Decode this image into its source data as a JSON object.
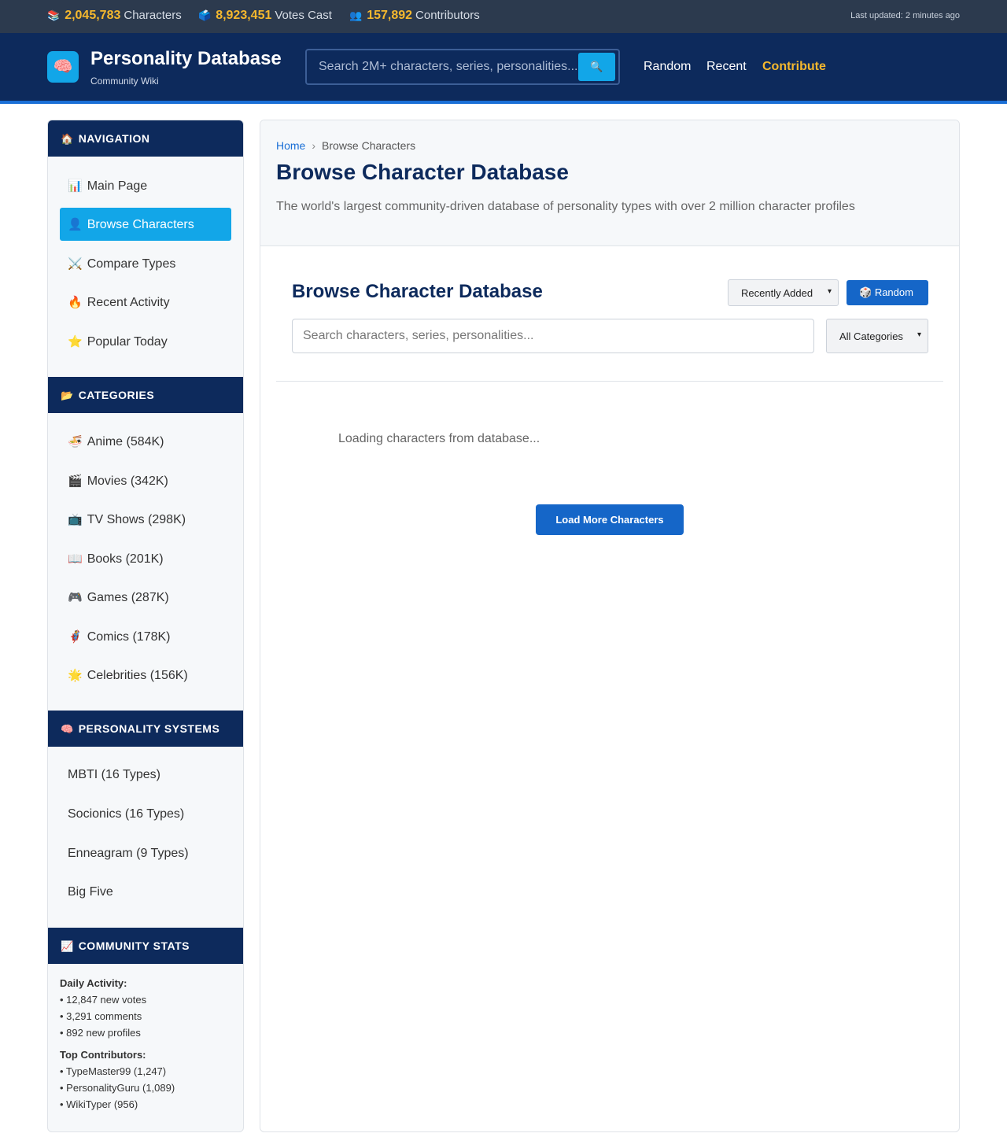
{
  "topbar": {
    "stats": [
      {
        "icon": "📚",
        "value": "2,045,783",
        "label": "Characters"
      },
      {
        "icon": "🗳️",
        "value": "8,923,451",
        "label": "Votes Cast"
      },
      {
        "icon": "👥",
        "value": "157,892",
        "label": "Contributors"
      }
    ],
    "updated": "Last updated: 2 minutes ago"
  },
  "header": {
    "logo_icon": "🧠",
    "title": "Personality Database",
    "subtitle": "Community Wiki",
    "search_placeholder": "Search 2M+ characters, series, personalities...",
    "search_icon": "🔍",
    "nav": [
      "Random",
      "Recent",
      "Contribute"
    ]
  },
  "sidebar": {
    "navigation": {
      "icon": "🏠",
      "title": "NAVIGATION",
      "items": [
        {
          "icon": "📊",
          "label": "Main Page"
        },
        {
          "icon": "👤",
          "label": "Browse Characters"
        },
        {
          "icon": "⚔️",
          "label": "Compare Types"
        },
        {
          "icon": "🔥",
          "label": "Recent Activity"
        },
        {
          "icon": "⭐",
          "label": "Popular Today"
        }
      ]
    },
    "categories": {
      "icon": "📂",
      "title": "CATEGORIES",
      "items": [
        {
          "icon": "🍜",
          "label": "Anime (584K)"
        },
        {
          "icon": "🎬",
          "label": "Movies (342K)"
        },
        {
          "icon": "📺",
          "label": "TV Shows (298K)"
        },
        {
          "icon": "📖",
          "label": "Books (201K)"
        },
        {
          "icon": "🎮",
          "label": "Games (287K)"
        },
        {
          "icon": "🦸",
          "label": "Comics (178K)"
        },
        {
          "icon": "🌟",
          "label": "Celebrities (156K)"
        }
      ]
    },
    "systems": {
      "icon": "🧠",
      "title": "PERSONALITY SYSTEMS",
      "items": [
        {
          "label": "MBTI (16 Types)"
        },
        {
          "label": "Socionics (16 Types)"
        },
        {
          "label": "Enneagram (9 Types)"
        },
        {
          "label": "Big Five"
        }
      ]
    },
    "community": {
      "icon": "📈",
      "title": "COMMUNITY STATS",
      "daily_label": "Daily Activity:",
      "daily": [
        "• 12,847 new votes",
        "• 3,291 comments",
        "• 892 new profiles"
      ],
      "top_label": "Top Contributors:",
      "top": [
        "• TypeMaster99 (1,247)",
        "• PersonalityGuru (1,089)",
        "• WikiTyper (956)"
      ]
    }
  },
  "main": {
    "breadcrumb": {
      "home": "Home",
      "separator": "›",
      "current": "Browse Characters"
    },
    "title": "Browse Character Database",
    "description": "The world's largest community-driven database of personality types with over 2 million character profiles",
    "section_title": "Browse Character Database",
    "sort_value": "Recently Added",
    "random_icon": "🎲",
    "random_label": "Random",
    "search_placeholder": "Search characters, series, personalities...",
    "category_value": "All Categories",
    "caret": "▾",
    "loading": "Loading characters from database...",
    "load_more": "Load More Characters"
  }
}
